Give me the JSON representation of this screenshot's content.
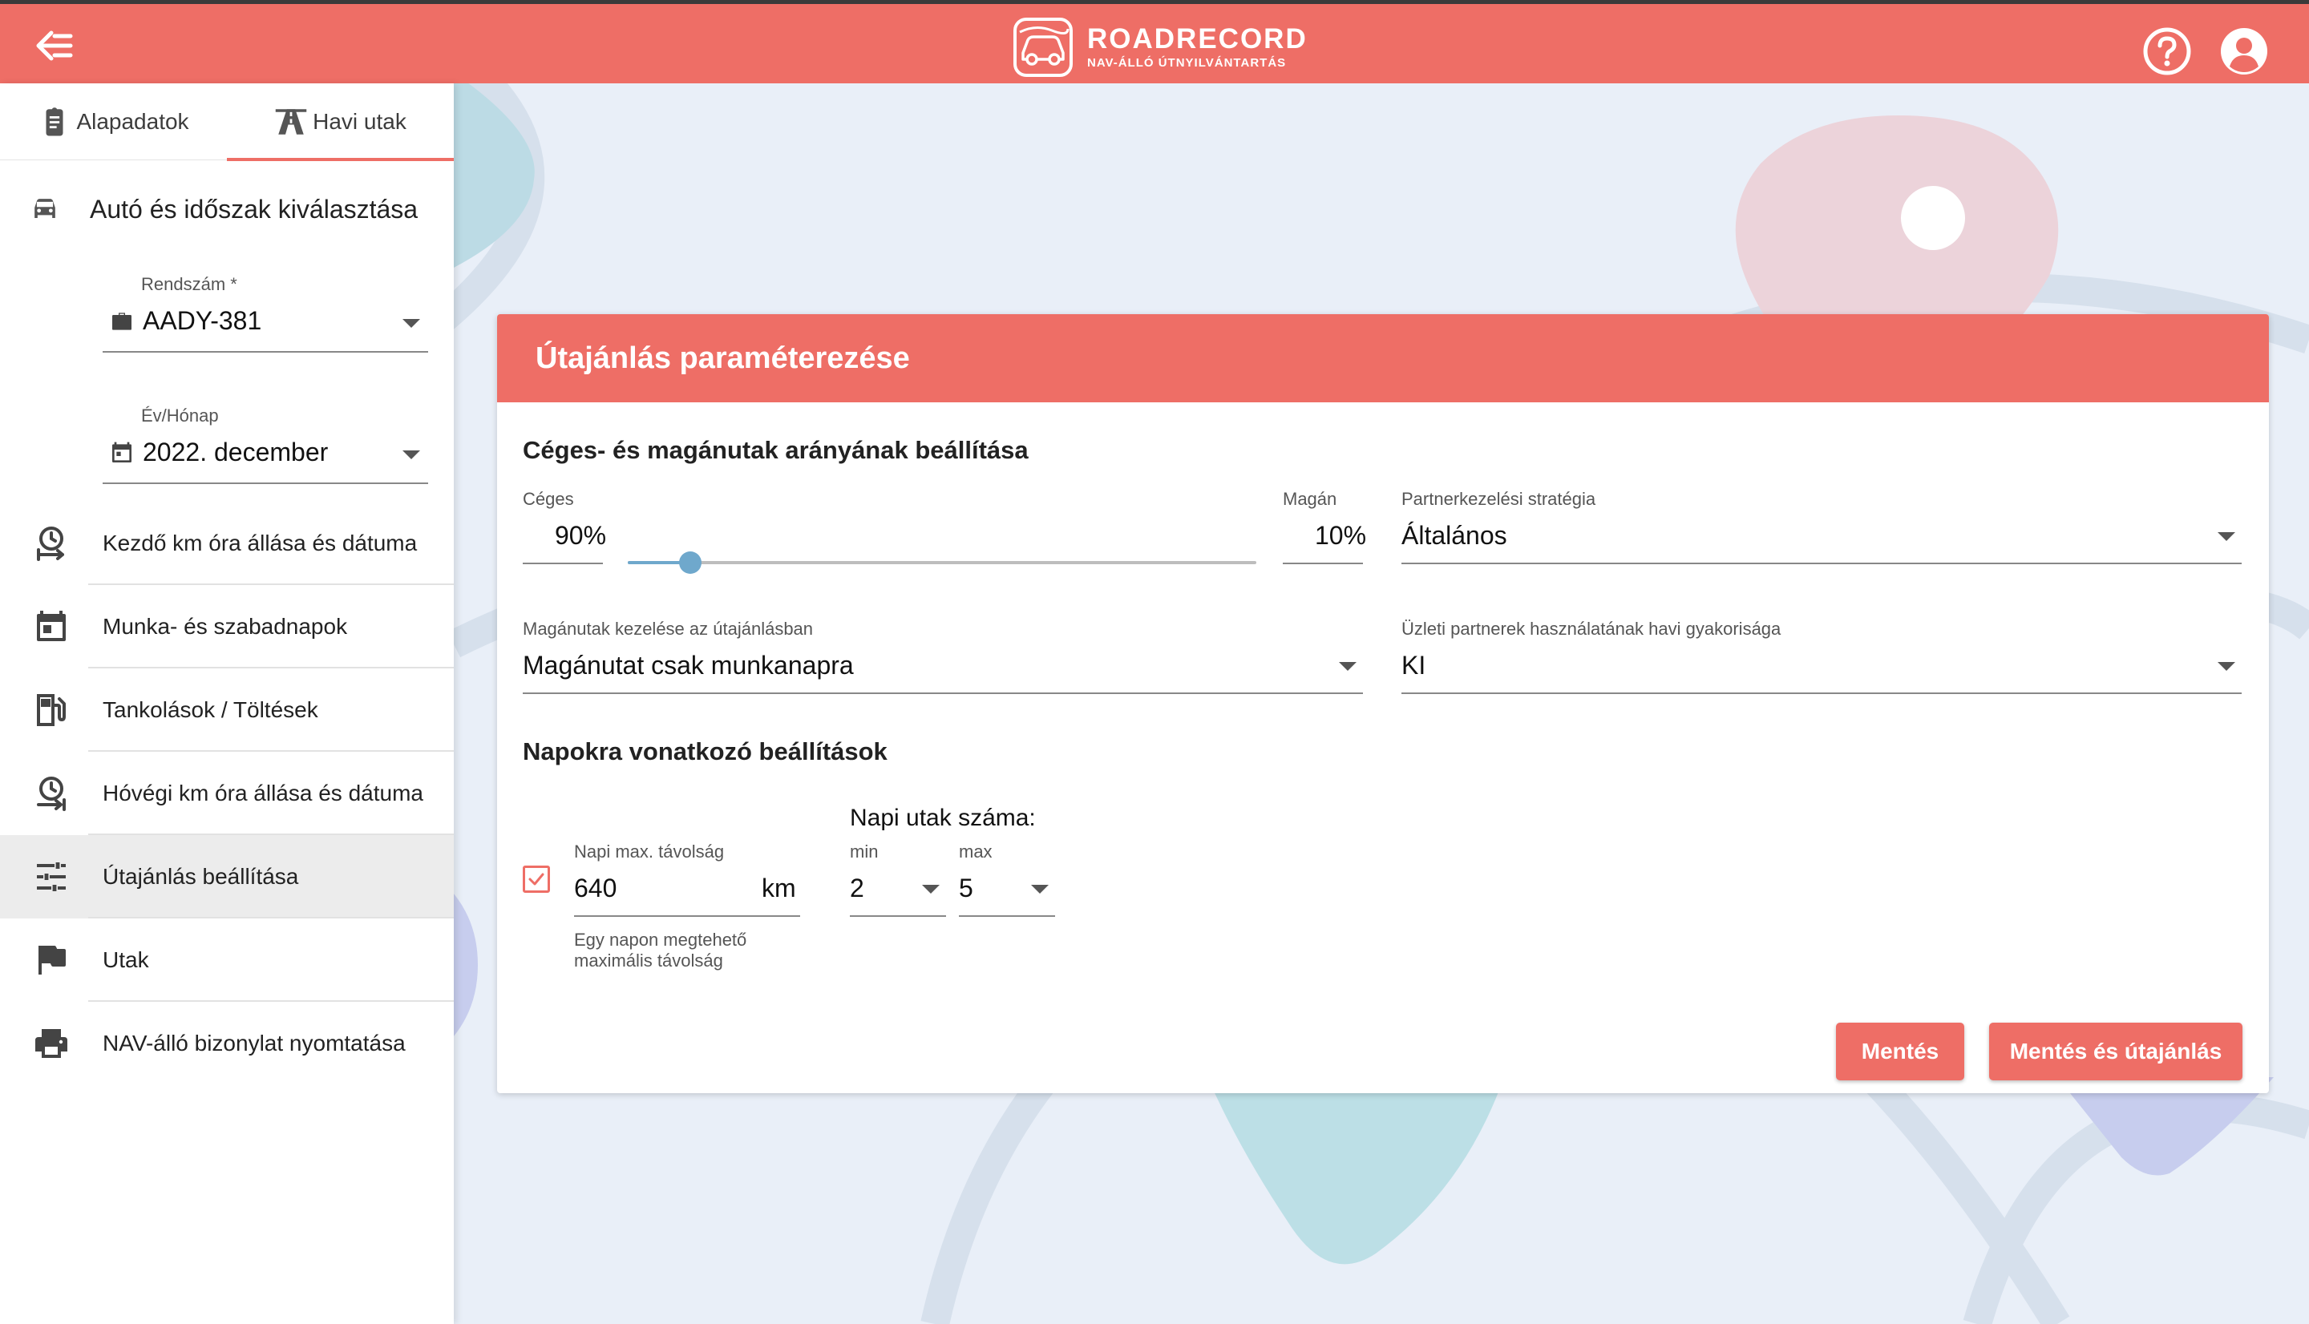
{
  "brand": {
    "name": "ROADRECORD",
    "tagline": "NAV-ÁLLÓ ÚTNYILVÁNTARTÁS"
  },
  "colors": {
    "accent": "#ee6e66",
    "slider": "#6fa8cc",
    "active_nav_bg": "#ececec"
  },
  "sidebar": {
    "tabs": [
      {
        "label": "Alapadatok",
        "icon": "clipboard-icon"
      },
      {
        "label": "Havi utak",
        "icon": "road-icon",
        "active": true
      }
    ],
    "section_title": "Autó és időszak kiválasztása",
    "plate": {
      "label": "Rendszám *",
      "value": "AADY-381"
    },
    "period": {
      "label": "Év/Hónap",
      "value": "2022. december"
    },
    "items": [
      {
        "label": "Kezdő km óra állása és dátuma",
        "icon": "odometer-start-icon"
      },
      {
        "label": "Munka- és szabadnapok",
        "icon": "calendar-icon"
      },
      {
        "label": "Tankolások / Töltések",
        "icon": "fuel-icon"
      },
      {
        "label": "Hóvégi km óra állása és dátuma",
        "icon": "odometer-end-icon"
      },
      {
        "label": "Útajánlás beállítása",
        "icon": "tune-icon",
        "active": true
      },
      {
        "label": "Utak",
        "icon": "flag-icon"
      },
      {
        "label": "NAV-álló bizonylat nyomtatása",
        "icon": "print-icon"
      }
    ]
  },
  "card": {
    "title": "Útajánlás paraméterezése",
    "ratio_section": "Céges- és magánutak arányának beállítása",
    "business": {
      "label": "Céges",
      "value": "90%"
    },
    "private": {
      "label": "Magán",
      "value": "10%"
    },
    "slider_private_fraction": 0.1,
    "partner_strategy": {
      "label": "Partnerkezelési stratégia",
      "value": "Általános"
    },
    "private_handling": {
      "label": "Magánutak kezelése az útajánlásban",
      "value": "Magánutat csak munkanapra"
    },
    "partner_frequency": {
      "label": "Üzleti partnerek használatának havi gyakorisága",
      "value": "KI"
    },
    "days_section": "Napokra vonatkozó beállítások",
    "daily_max": {
      "label": "Napi max. távolság",
      "value": "640",
      "unit": "km",
      "checked": true,
      "hint": "Egy napon megtehető maximális távolság"
    },
    "daily_trips": {
      "title": "Napi utak száma:",
      "min_label": "min",
      "min_value": "2",
      "max_label": "max",
      "max_value": "5"
    },
    "buttons": {
      "save": "Mentés",
      "save_and_recommend": "Mentés és útajánlás"
    }
  }
}
